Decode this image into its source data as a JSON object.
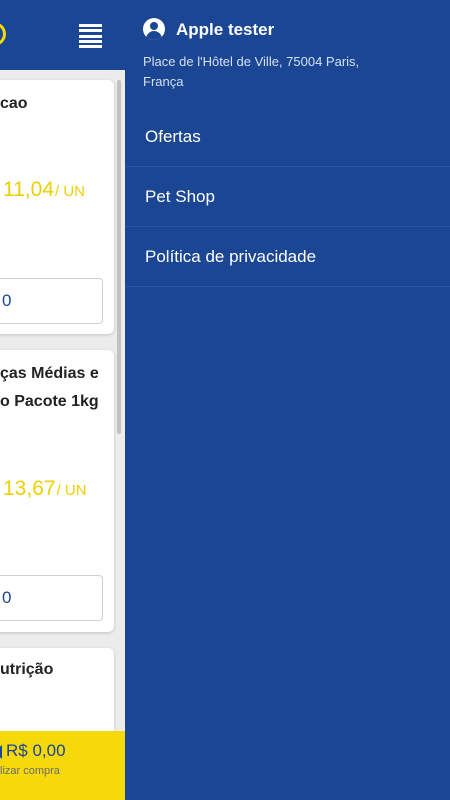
{
  "app": {
    "cards": [
      {
        "name": "cao",
        "price": "11,04",
        "unit": "/ UN",
        "field": "0"
      },
      {
        "name_lines": [
          "ças Médias e",
          "o Pacote 1kg"
        ],
        "price": "13,67",
        "unit": "/ UN",
        "field": "0"
      },
      {
        "name": "utrição"
      }
    ],
    "cart": {
      "total": "R$ 0,00",
      "subtitle": "lizar compra"
    }
  },
  "drawer": {
    "user": {
      "name": "Apple tester",
      "address": "Place de l'Hôtel de Ville, 75004 Paris, França"
    },
    "menu": [
      {
        "label": "Ofertas"
      },
      {
        "label": "Pet Shop"
      },
      {
        "label": "Política de privacidade"
      }
    ]
  },
  "colors": {
    "primary": "#1a4694",
    "accent": "#f5d90a",
    "price": "#f0cf00"
  },
  "icons": {
    "user": "account-circle-icon",
    "menu": "list-menu-icon"
  }
}
